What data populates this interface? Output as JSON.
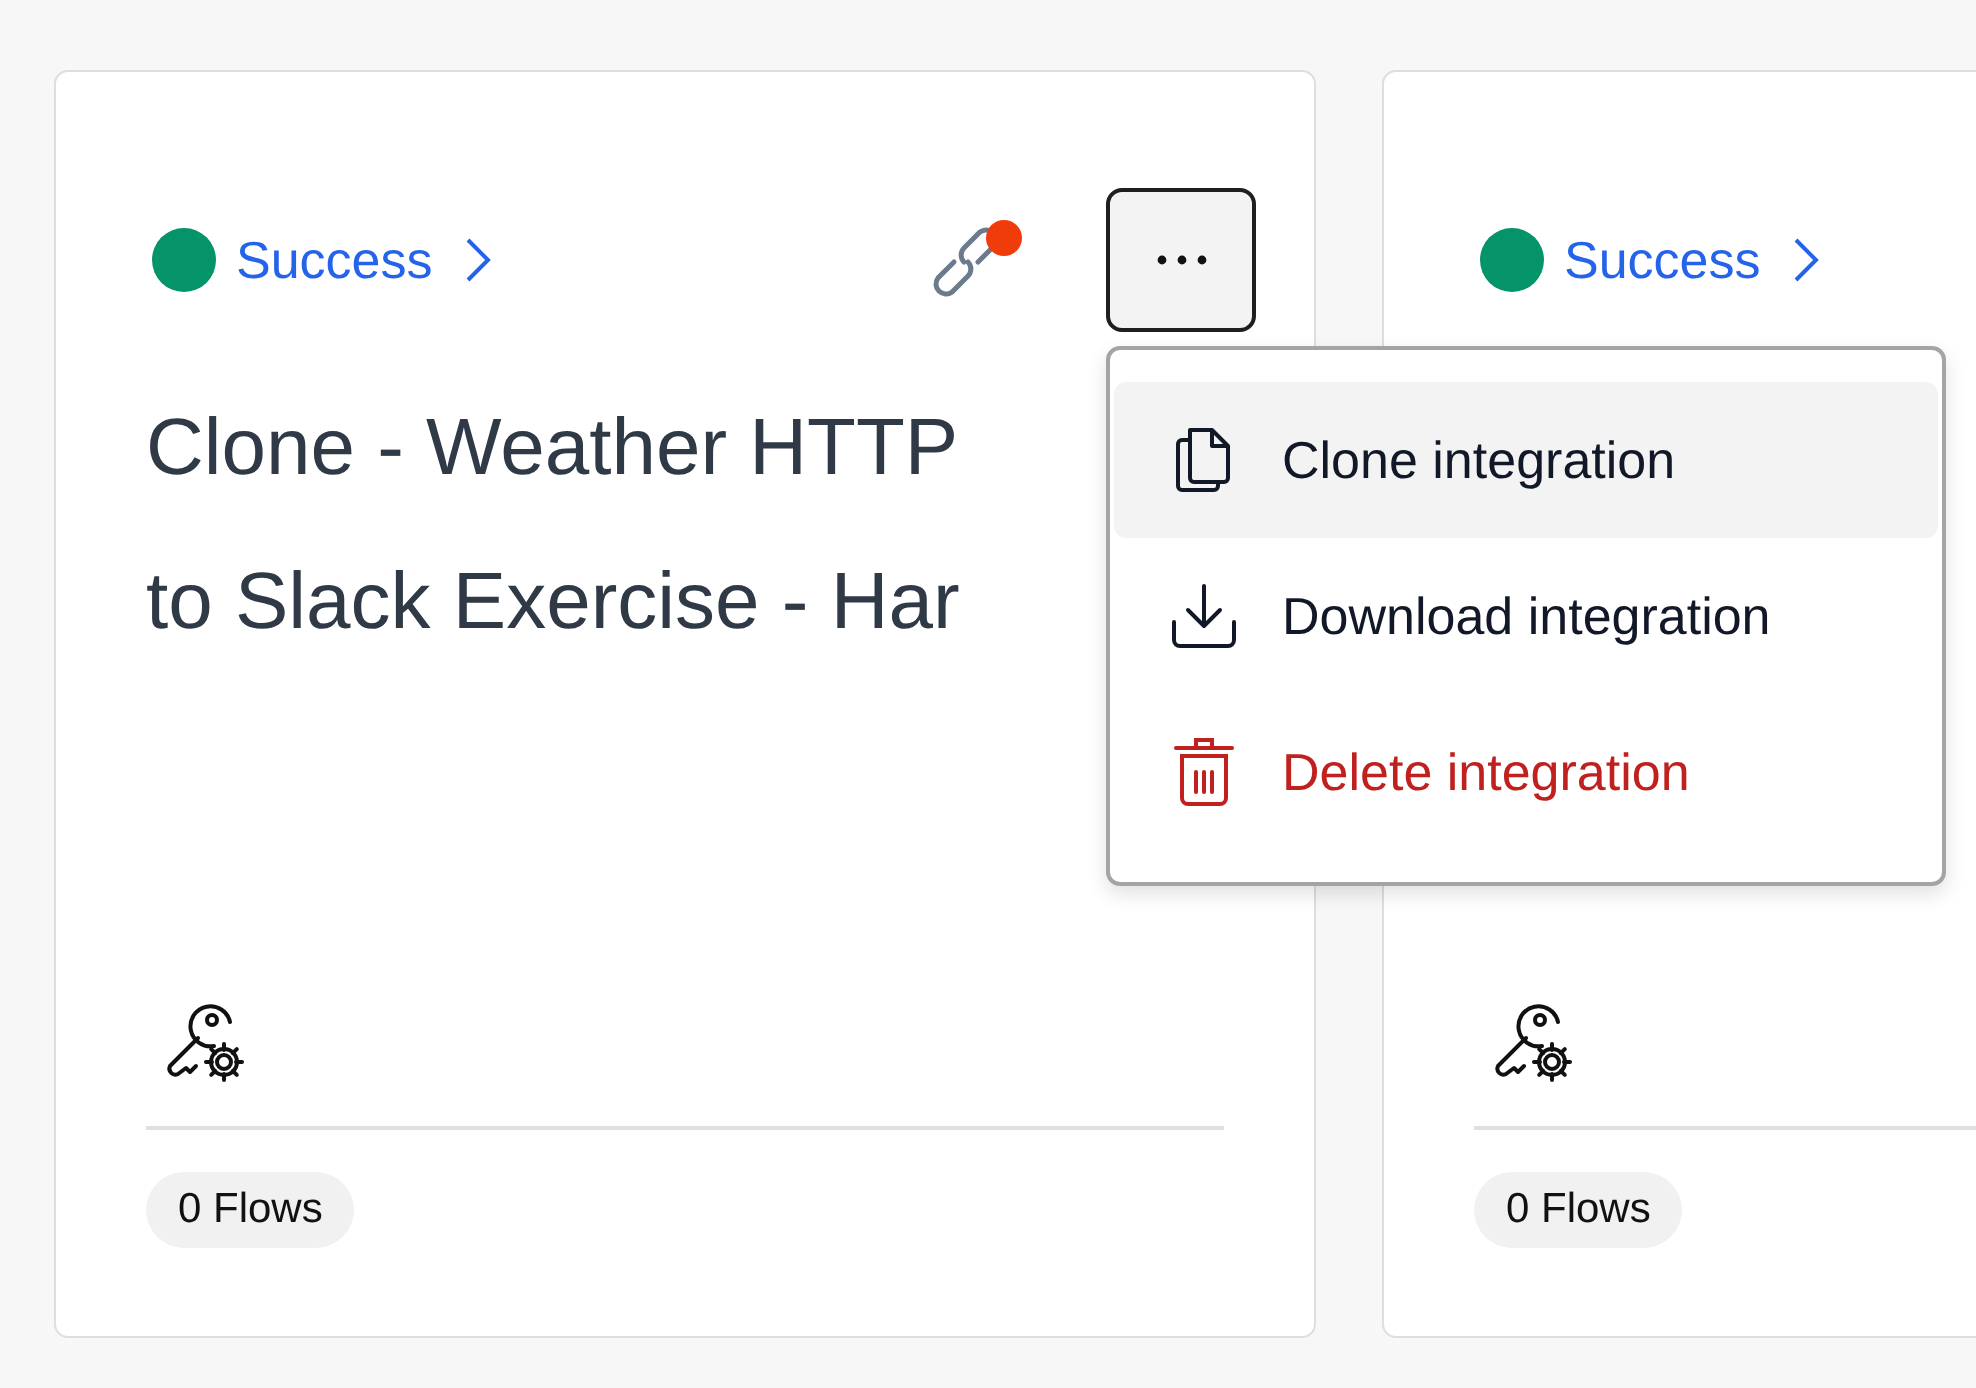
{
  "cards": [
    {
      "status": {
        "label": "Success",
        "color": "#05936a"
      },
      "link": {
        "alert": true
      },
      "title_lines": [
        "Clone - Weather HTTP",
        "to Slack Exercise - Har"
      ],
      "more_button": true,
      "flows": "0 Flows"
    },
    {
      "status": {
        "label": "Success",
        "color": "#05936a"
      },
      "flows": "0 Flows"
    }
  ],
  "menu": {
    "items": [
      {
        "label": "Clone integration",
        "kind": "clone",
        "selected": true
      },
      {
        "label": "Download integration",
        "kind": "download",
        "selected": false
      },
      {
        "label": "Delete integration",
        "kind": "delete",
        "selected": false
      }
    ]
  }
}
